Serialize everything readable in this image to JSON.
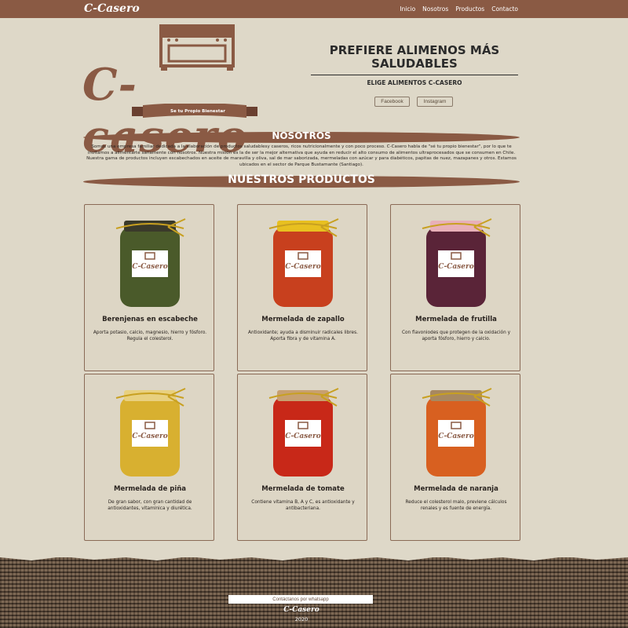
{
  "nav": {
    "brand": "C-Casero",
    "links": [
      "Inicio",
      "Nosotros",
      "Productos",
      "Contacto"
    ]
  },
  "logo": {
    "wordmark": "C-casero",
    "tagline": "Se tu Propio Bienestar"
  },
  "hero": {
    "title": "PREFIERE ALIMENOS MÁS SALUDABLES",
    "subtitle": "ELIGE ALIMENTOS C-CASERO",
    "facebook": "Facebook",
    "instagram": "Instagram"
  },
  "about": {
    "title": "NOSOTROS",
    "text": "Somos una empresa familiar dedicada a la elaboración de productos saludablesy caseros, ricos nutricionalmente y con poco proceso. C-Casero habla de \"sé tu propio bienestar\", por lo que te invitamos a alimentarte sanamente con nosotros. Nuestra misión es la de ser la mejor alternativa que ayuda en reducir el alto consumo de alimentos ultraprocesados que se consumen en Chile. Nuestra gama de productos incluyen escabechados en aceite de maravilla y oliva, sal de mar saborizada, mermeladas con azúcar y para diabéticos, papitas de nuez, mazapanes y otros. Estamos ubicados en el sector de Parque Bustamante (Santiago)."
  },
  "products": {
    "title": "NUESTROS PRODUCTOS",
    "items": [
      {
        "name": "Berenjenas en escabeche",
        "desc": "Aporta potasio, calcio, magnesio, hierro y fósforo. Regula el colesterol.",
        "fill": "#4a5a2a",
        "cap": "#3a3a2a",
        "label": "C-Casero"
      },
      {
        "name": "Mermelada de zapallo",
        "desc": "Antioxidante; ayuda a disminuir radicales libres. Aporta fibra y de vitamina A.",
        "fill": "#c8401e",
        "cap": "#e8c020",
        "label": "C-Casero"
      },
      {
        "name": "Mermelada de frutilla",
        "desc": "Con flavoniodes que protegen de la oxidación y aporta fósforo, hierro y calcio.",
        "fill": "#5a2438",
        "cap": "#e8b0b8",
        "label": "C-Casero"
      },
      {
        "name": "Mermelada de piña",
        "desc": "De gran sabor, con gran cantidad de antioxidantes, vitaminica y diurética.",
        "fill": "#d8b030",
        "cap": "#e8d080",
        "label": "C-Casero"
      },
      {
        "name": "Mermelada de tomate",
        "desc": "Contiene vitamina B, A y C, es antioxidante y antibacteriana.",
        "fill": "#c82818",
        "cap": "#c8a070",
        "label": "C-Casero"
      },
      {
        "name": "Mermelada de naranja",
        "desc": "Reduce el colesterol malo, previene cálculos renales y es fuente de energía.",
        "fill": "#d86020",
        "cap": "#a88860",
        "label": "C-Casero"
      }
    ]
  },
  "footer": {
    "whatsapp": "Contáctanos por whatsapp",
    "brand": "C-Casero",
    "year": "2020"
  },
  "colors": {
    "brand_brown": "#8a5a44",
    "background": "#ded8c8",
    "ribbon": "#c8a020"
  }
}
